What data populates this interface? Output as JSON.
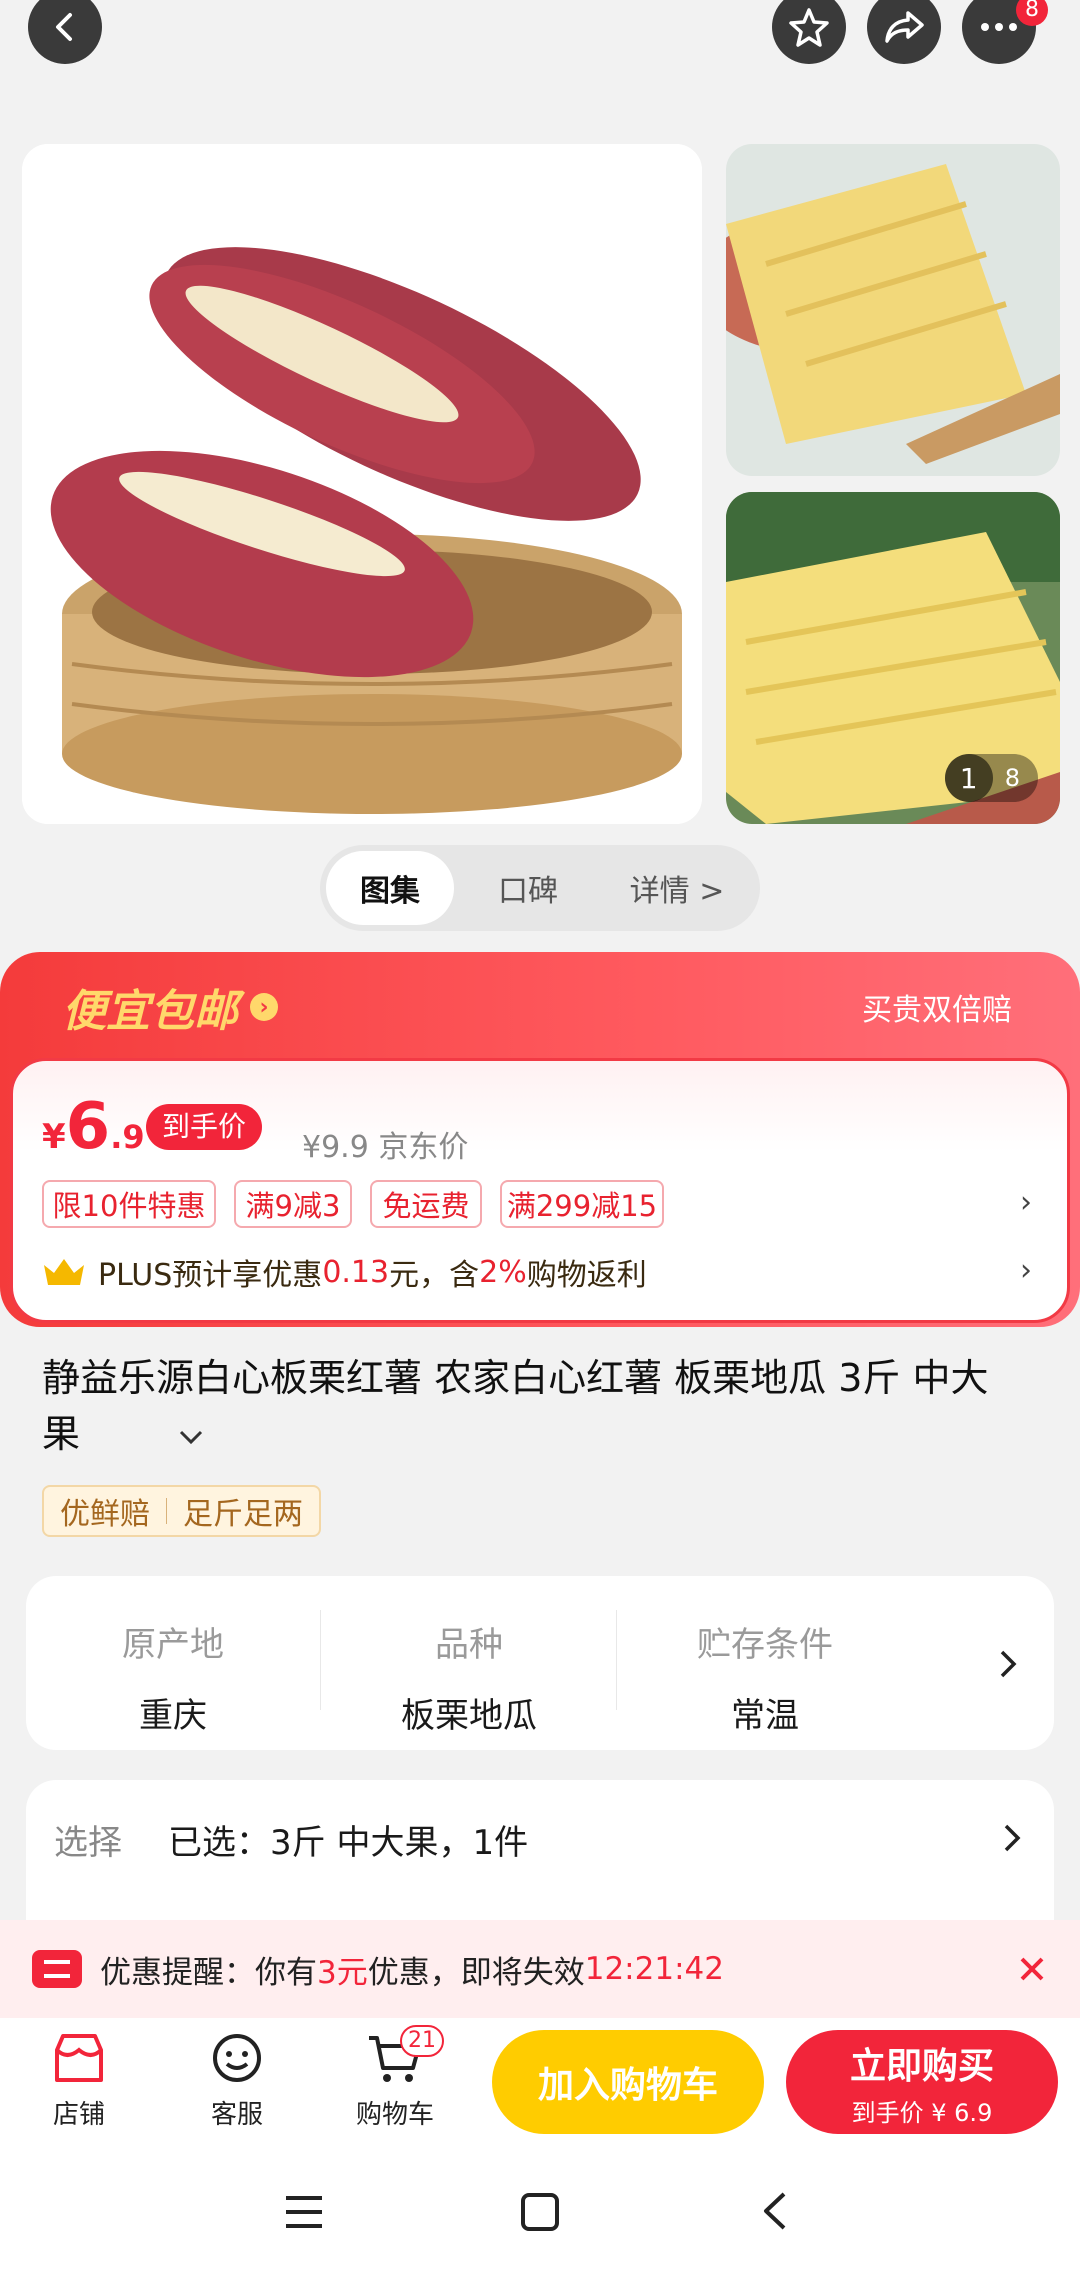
{
  "topbar": {
    "more_badge": "8"
  },
  "gallery": {
    "counter_current": "1",
    "counter_total": "8"
  },
  "tabs": [
    {
      "label": "图集"
    },
    {
      "label": "口碑"
    },
    {
      "label": "详情 >"
    }
  ],
  "promo": {
    "banner_title": "便宜包邮",
    "banner_right": "买贵双倍赔",
    "currency": "¥",
    "price_int": "6",
    "price_dec": ".9",
    "price_tag": "到手价",
    "jd_price": "¥9.9 京东价",
    "tags": [
      "限10件特惠",
      "满9减3",
      "免运费",
      "满299减15"
    ],
    "plus_prefix": "PLUS预计享优惠",
    "plus_amount": "0.13",
    "plus_mid": "元，含",
    "plus_pct": "2%",
    "plus_suffix": "购物返利"
  },
  "product": {
    "title": "静益乐源白心板栗红薯 农家白心红薯 板栗地瓜 3斤 中大果",
    "labels": [
      "优鲜赔",
      "足斤足两"
    ]
  },
  "specs": [
    {
      "label": "原产地",
      "value": "重庆"
    },
    {
      "label": "品种",
      "value": "板栗地瓜"
    },
    {
      "label": "贮存条件",
      "value": "常温"
    }
  ],
  "select": {
    "label": "选择",
    "value": "已选：3斤 中大果，1件"
  },
  "notice": {
    "prefix": "优惠提醒：你有",
    "amount": "3元",
    "middle": "优惠，即将失效",
    "countdown": "12:21:42"
  },
  "bottom": {
    "shop": "店铺",
    "service": "客服",
    "cart": "购物车",
    "cart_badge": "21",
    "add_cart": "加入购物车",
    "buy_now": "立即购买",
    "buy_sub": "到手价 ¥ 6.9"
  },
  "colors": {
    "brand_red": "#f2253a",
    "cart_yellow": "#ffcc00",
    "banner_gold": "#ffd86b"
  }
}
